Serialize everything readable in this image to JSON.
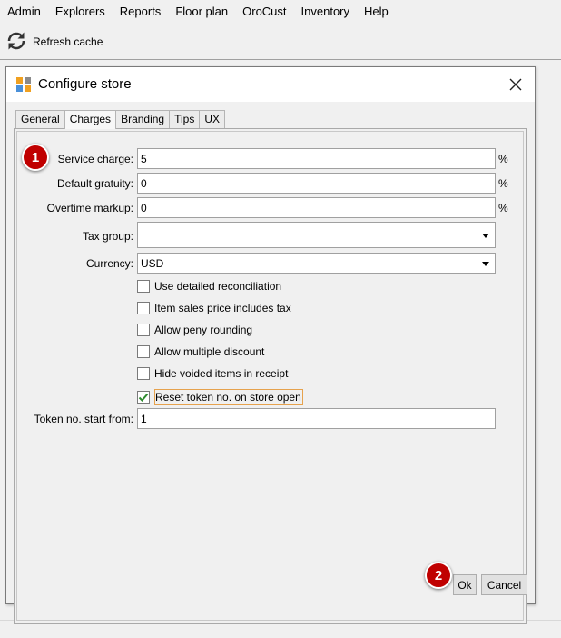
{
  "menu": [
    "Admin",
    "Explorers",
    "Reports",
    "Floor plan",
    "OroCust",
    "Inventory",
    "Help"
  ],
  "toolbar": {
    "refresh_label": "Refresh cache"
  },
  "dialog": {
    "title": "Configure store",
    "tabs": [
      "General",
      "Charges",
      "Branding",
      "Tips",
      "UX"
    ],
    "active_tab": "Charges",
    "fields": {
      "service_charge": {
        "label": "Service charge:",
        "value": "5",
        "unit": "%"
      },
      "default_gratuity": {
        "label": "Default gratuity:",
        "value": "0",
        "unit": "%"
      },
      "overtime_markup": {
        "label": "Overtime markup:",
        "value": "0",
        "unit": "%"
      },
      "tax_group": {
        "label": "Tax group:",
        "value": ""
      },
      "currency": {
        "label": "Currency:",
        "value": "USD"
      },
      "token_start": {
        "label": "Token no. start from:",
        "value": "1"
      }
    },
    "checkboxes": [
      {
        "label": "Use detailed reconciliation",
        "checked": false
      },
      {
        "label": "Item sales price includes tax",
        "checked": false
      },
      {
        "label": "Allow peny rounding",
        "checked": false
      },
      {
        "label": "Allow multiple discount",
        "checked": false
      },
      {
        "label": "Hide voided items in receipt",
        "checked": false
      },
      {
        "label": "Reset token no. on store open",
        "checked": true
      }
    ],
    "buttons": {
      "ok": "Ok",
      "cancel": "Cancel"
    }
  },
  "badges": [
    "1",
    "2"
  ],
  "colors": {
    "badge": "#c00000",
    "focus_border": "#e6a24d",
    "check": "#2e8b2e"
  }
}
